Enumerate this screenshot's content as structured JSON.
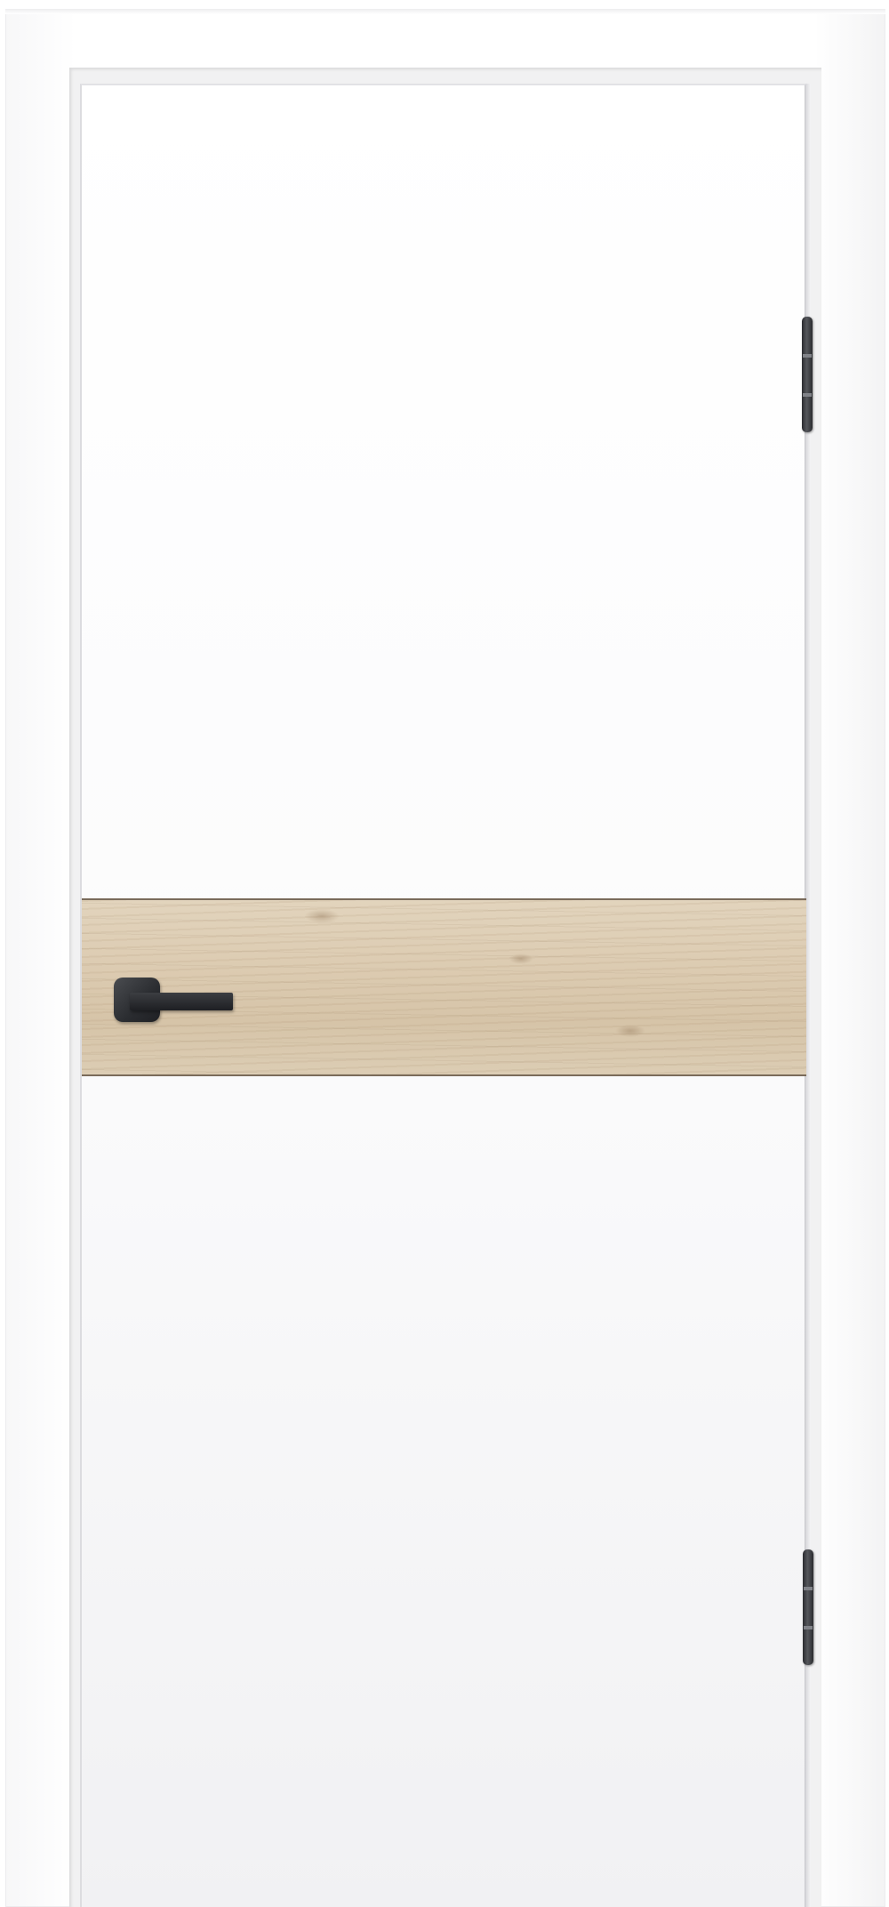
{
  "scene": {
    "subject": "interior door",
    "colors": {
      "door": "#ffffff",
      "frame": "#f7f7f8",
      "wood_insert": "#dccbb1",
      "hardware": "#2a2c30"
    },
    "icons": [
      "door-handle-icon",
      "hinge-icon"
    ]
  }
}
